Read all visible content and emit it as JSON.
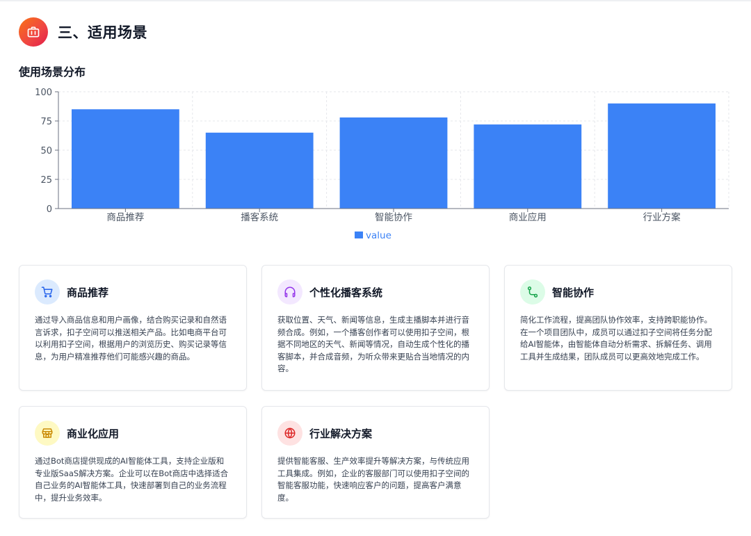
{
  "section": {
    "title": "三、适用场景",
    "icon": "briefcase-icon",
    "icon_gradient": [
      "#f97316",
      "#e11d48"
    ]
  },
  "chart_title": "使用场景分布",
  "chart_data": {
    "type": "bar",
    "title": "使用场景分布",
    "categories": [
      "商品推荐",
      "播客系统",
      "智能协作",
      "商业应用",
      "行业方案"
    ],
    "series": [
      {
        "name": "value",
        "values": [
          85,
          65,
          78,
          72,
          90
        ],
        "color": "#3b82f6"
      }
    ],
    "ylim": [
      0,
      100
    ],
    "yticks": [
      0,
      25,
      50,
      75,
      100
    ],
    "grid": true,
    "grid_style": "dashed",
    "legend": "bottom-center",
    "xlabel": "",
    "ylabel": ""
  },
  "cards": [
    {
      "title": "商品推荐",
      "icon": "shopping-cart-icon",
      "icon_bg": "#dbeafe",
      "icon_color": "#2563eb",
      "desc": "通过导入商品信息和用户画像，结合购买记录和自然语言诉求，扣子空间可以推送相关产品。比如电商平台可以利用扣子空间，根据用户的浏览历史、购买记录等信息，为用户精准推荐他们可能感兴趣的商品。"
    },
    {
      "title": "个性化播客系统",
      "icon": "headphones-icon",
      "icon_bg": "#f3e8ff",
      "icon_color": "#9333ea",
      "desc": "获取位置、天气、新闻等信息，生成主播脚本并进行音频合成。例如，一个播客创作者可以使用扣子空间，根据不同地区的天气、新闻等情况，自动生成个性化的播客脚本，并合成音频，为听众带来更贴合当地情况的内容。"
    },
    {
      "title": "智能协作",
      "icon": "route-icon",
      "icon_bg": "#dcfce7",
      "icon_color": "#16a34a",
      "desc": "简化工作流程，提高团队协作效率，支持跨职能协作。在一个项目团队中，成员可以通过扣子空间将任务分配给AI智能体，由智能体自动分析需求、拆解任务、调用工具并生成结果，团队成员可以更高效地完成工作。"
    },
    {
      "title": "商业化应用",
      "icon": "store-icon",
      "icon_bg": "#fef9c3",
      "icon_color": "#ca8a04",
      "desc": "通过Bot商店提供现成的AI智能体工具，支持企业版和专业版SaaS解决方案。企业可以在Bot商店中选择适合自己业务的AI智能体工具，快速部署到自己的业务流程中，提升业务效率。"
    },
    {
      "title": "行业解决方案",
      "icon": "globe-icon",
      "icon_bg": "#fee2e2",
      "icon_color": "#dc2626",
      "desc": "提供智能客服、生产效率提升等解决方案，与传统应用工具集成。例如，企业的客服部门可以使用扣子空间的智能客服功能，快速响应客户的问题，提高客户满意度。"
    }
  ]
}
